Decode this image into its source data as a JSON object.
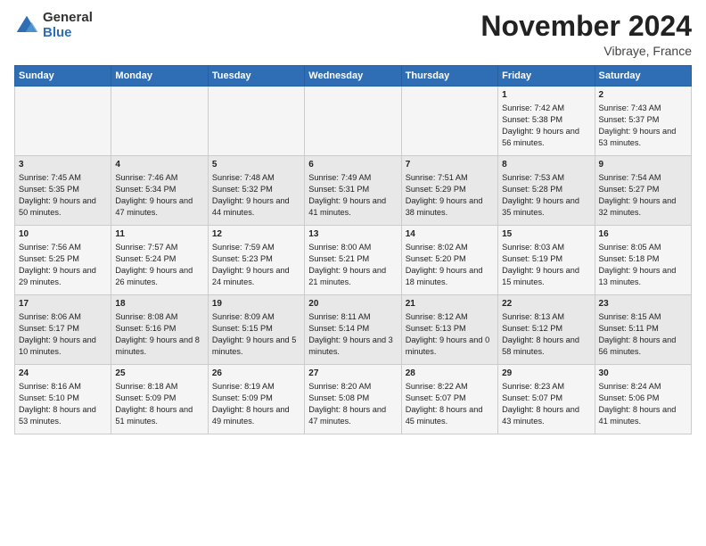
{
  "logo": {
    "general": "General",
    "blue": "Blue"
  },
  "title": "November 2024",
  "subtitle": "Vibraye, France",
  "days_header": [
    "Sunday",
    "Monday",
    "Tuesday",
    "Wednesday",
    "Thursday",
    "Friday",
    "Saturday"
  ],
  "weeks": [
    [
      {
        "day": "",
        "info": ""
      },
      {
        "day": "",
        "info": ""
      },
      {
        "day": "",
        "info": ""
      },
      {
        "day": "",
        "info": ""
      },
      {
        "day": "",
        "info": ""
      },
      {
        "day": "1",
        "info": "Sunrise: 7:42 AM\nSunset: 5:38 PM\nDaylight: 9 hours and 56 minutes."
      },
      {
        "day": "2",
        "info": "Sunrise: 7:43 AM\nSunset: 5:37 PM\nDaylight: 9 hours and 53 minutes."
      }
    ],
    [
      {
        "day": "3",
        "info": "Sunrise: 7:45 AM\nSunset: 5:35 PM\nDaylight: 9 hours and 50 minutes."
      },
      {
        "day": "4",
        "info": "Sunrise: 7:46 AM\nSunset: 5:34 PM\nDaylight: 9 hours and 47 minutes."
      },
      {
        "day": "5",
        "info": "Sunrise: 7:48 AM\nSunset: 5:32 PM\nDaylight: 9 hours and 44 minutes."
      },
      {
        "day": "6",
        "info": "Sunrise: 7:49 AM\nSunset: 5:31 PM\nDaylight: 9 hours and 41 minutes."
      },
      {
        "day": "7",
        "info": "Sunrise: 7:51 AM\nSunset: 5:29 PM\nDaylight: 9 hours and 38 minutes."
      },
      {
        "day": "8",
        "info": "Sunrise: 7:53 AM\nSunset: 5:28 PM\nDaylight: 9 hours and 35 minutes."
      },
      {
        "day": "9",
        "info": "Sunrise: 7:54 AM\nSunset: 5:27 PM\nDaylight: 9 hours and 32 minutes."
      }
    ],
    [
      {
        "day": "10",
        "info": "Sunrise: 7:56 AM\nSunset: 5:25 PM\nDaylight: 9 hours and 29 minutes."
      },
      {
        "day": "11",
        "info": "Sunrise: 7:57 AM\nSunset: 5:24 PM\nDaylight: 9 hours and 26 minutes."
      },
      {
        "day": "12",
        "info": "Sunrise: 7:59 AM\nSunset: 5:23 PM\nDaylight: 9 hours and 24 minutes."
      },
      {
        "day": "13",
        "info": "Sunrise: 8:00 AM\nSunset: 5:21 PM\nDaylight: 9 hours and 21 minutes."
      },
      {
        "day": "14",
        "info": "Sunrise: 8:02 AM\nSunset: 5:20 PM\nDaylight: 9 hours and 18 minutes."
      },
      {
        "day": "15",
        "info": "Sunrise: 8:03 AM\nSunset: 5:19 PM\nDaylight: 9 hours and 15 minutes."
      },
      {
        "day": "16",
        "info": "Sunrise: 8:05 AM\nSunset: 5:18 PM\nDaylight: 9 hours and 13 minutes."
      }
    ],
    [
      {
        "day": "17",
        "info": "Sunrise: 8:06 AM\nSunset: 5:17 PM\nDaylight: 9 hours and 10 minutes."
      },
      {
        "day": "18",
        "info": "Sunrise: 8:08 AM\nSunset: 5:16 PM\nDaylight: 9 hours and 8 minutes."
      },
      {
        "day": "19",
        "info": "Sunrise: 8:09 AM\nSunset: 5:15 PM\nDaylight: 9 hours and 5 minutes."
      },
      {
        "day": "20",
        "info": "Sunrise: 8:11 AM\nSunset: 5:14 PM\nDaylight: 9 hours and 3 minutes."
      },
      {
        "day": "21",
        "info": "Sunrise: 8:12 AM\nSunset: 5:13 PM\nDaylight: 9 hours and 0 minutes."
      },
      {
        "day": "22",
        "info": "Sunrise: 8:13 AM\nSunset: 5:12 PM\nDaylight: 8 hours and 58 minutes."
      },
      {
        "day": "23",
        "info": "Sunrise: 8:15 AM\nSunset: 5:11 PM\nDaylight: 8 hours and 56 minutes."
      }
    ],
    [
      {
        "day": "24",
        "info": "Sunrise: 8:16 AM\nSunset: 5:10 PM\nDaylight: 8 hours and 53 minutes."
      },
      {
        "day": "25",
        "info": "Sunrise: 8:18 AM\nSunset: 5:09 PM\nDaylight: 8 hours and 51 minutes."
      },
      {
        "day": "26",
        "info": "Sunrise: 8:19 AM\nSunset: 5:09 PM\nDaylight: 8 hours and 49 minutes."
      },
      {
        "day": "27",
        "info": "Sunrise: 8:20 AM\nSunset: 5:08 PM\nDaylight: 8 hours and 47 minutes."
      },
      {
        "day": "28",
        "info": "Sunrise: 8:22 AM\nSunset: 5:07 PM\nDaylight: 8 hours and 45 minutes."
      },
      {
        "day": "29",
        "info": "Sunrise: 8:23 AM\nSunset: 5:07 PM\nDaylight: 8 hours and 43 minutes."
      },
      {
        "day": "30",
        "info": "Sunrise: 8:24 AM\nSunset: 5:06 PM\nDaylight: 8 hours and 41 minutes."
      }
    ]
  ]
}
